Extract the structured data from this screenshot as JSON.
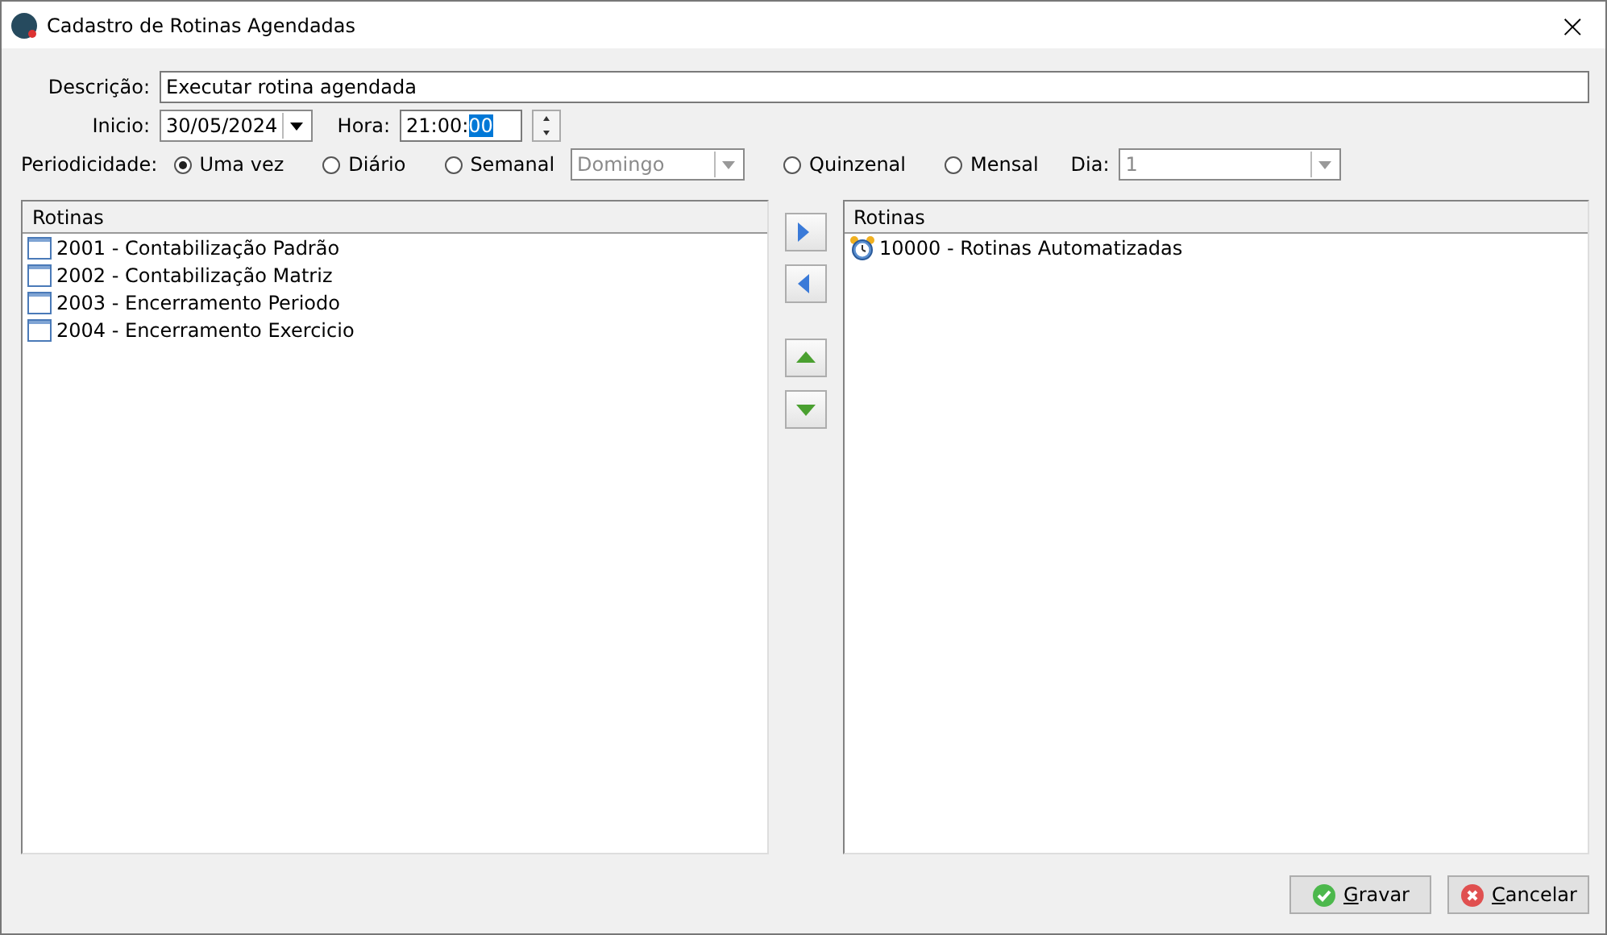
{
  "window": {
    "title": "Cadastro de Rotinas Agendadas",
    "close": "×"
  },
  "form": {
    "descricao_label": "Descrição:",
    "descricao": "Executar rotina agendada",
    "inicio_label": "Inicio:",
    "inicio": "30/05/2024",
    "hora_label": "Hora:",
    "hora": "21:00:",
    "hora_selected": "00",
    "periodicidade_label": "Periodicidade:",
    "periods": [
      {
        "label": "Uma vez",
        "selected": true
      },
      {
        "label": "Diário",
        "selected": false
      },
      {
        "label": "Semanal",
        "selected": false,
        "combo": "Domingo"
      },
      {
        "label": "Quinzenal",
        "selected": false
      },
      {
        "label": "Mensal",
        "selected": false
      }
    ],
    "dia_label": "Dia:",
    "dia": "1"
  },
  "available": {
    "header": "Rotinas",
    "items": [
      {
        "label": "2001 - Contabilização Padrão",
        "kind": "form"
      },
      {
        "label": "2002 - Contabilização Matriz",
        "kind": "form"
      },
      {
        "label": "2003 - Encerramento Periodo",
        "kind": "form"
      },
      {
        "label": "2004 - Encerramento Exercicio",
        "kind": "form"
      }
    ]
  },
  "selected_list": {
    "header": "Rotinas",
    "items": [
      {
        "label": "10000 - Rotinas Automatizadas",
        "kind": "alarm"
      }
    ]
  },
  "buttons": [
    {
      "kind": "ok",
      "accel": "G",
      "rest": "ravar"
    },
    {
      "kind": "cancel",
      "accel": "C",
      "rest": "ancelar"
    }
  ]
}
